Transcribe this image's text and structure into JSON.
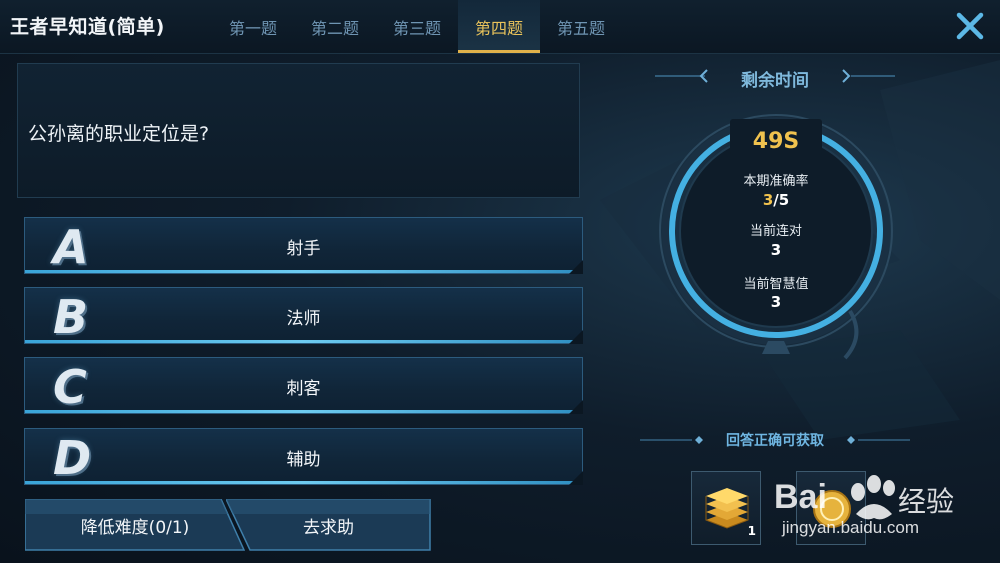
{
  "app": {
    "title": "王者早知道(简单)"
  },
  "tabs": [
    {
      "label": "第一题",
      "active": false
    },
    {
      "label": "第二题",
      "active": false
    },
    {
      "label": "第三题",
      "active": false
    },
    {
      "label": "第四题",
      "active": true
    },
    {
      "label": "第五题",
      "active": false
    }
  ],
  "question": {
    "text": "公孙离的职业定位是?"
  },
  "options": [
    {
      "letter": "A",
      "text": "射手"
    },
    {
      "letter": "B",
      "text": "法师"
    },
    {
      "letter": "C",
      "text": "刺客"
    },
    {
      "letter": "D",
      "text": "辅助"
    }
  ],
  "buttons": {
    "lower_difficulty": "降低难度(0/1)",
    "ask_help": "去求助"
  },
  "timer": {
    "title": "剩余时间",
    "remaining": "49S",
    "accuracy_label": "本期准确率",
    "accuracy_correct": "3",
    "accuracy_total": "/5",
    "streak_label": "当前连对",
    "streak_value": "3",
    "wisdom_label": "当前智慧值",
    "wisdom_value": "3"
  },
  "rewards": {
    "title": "回答正确可获取",
    "items": [
      {
        "icon": "gold-stack-icon",
        "count": "1"
      },
      {
        "icon": "coin-icon",
        "count": ""
      }
    ]
  },
  "watermark": {
    "brand": "Bai",
    "brand2": "经验",
    "url": "jingyan.baidu.com"
  },
  "colors": {
    "accent_gold": "#e0b14a",
    "accent_blue": "#3aa4d8",
    "bg": "#0f1d2b"
  }
}
